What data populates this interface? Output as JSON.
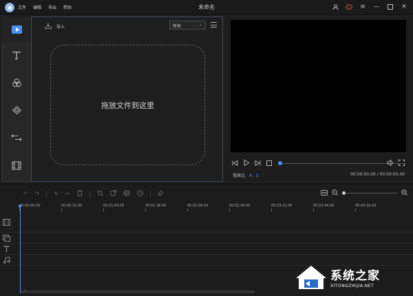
{
  "titlebar": {
    "menu": [
      "文件",
      "编辑",
      "导出",
      "帮助"
    ],
    "title": "未命名"
  },
  "media": {
    "import_label": "导入",
    "filter_value": "所有",
    "drop_text": "拖放文件到这里"
  },
  "preview": {
    "ratio_label": "宽高比",
    "ratio_value": "4 : 3",
    "timecode": "00:00:00.00 / 00:00:00.00",
    "seek_progress": 0
  },
  "timeline": {
    "ticks": [
      "00:00:00.00",
      "00:00:32.00",
      "00:01:04.00",
      "00:01:36.00",
      "00:02:08.00",
      "00:02:40.00",
      "00:03:12.00",
      "00:03:44.00",
      "00:04:16.00"
    ],
    "zoom_level": 0
  },
  "watermark": {
    "text": "系统之家",
    "sub": "XITONGZHIJIA.NET"
  },
  "colors": {
    "accent": "#4a8ff5",
    "background": "#202020",
    "panel": "#1e1e1e"
  }
}
